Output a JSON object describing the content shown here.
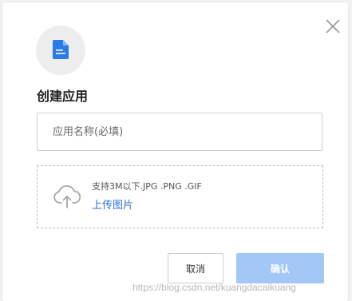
{
  "dialog": {
    "title": "创建应用",
    "close_icon": "close-icon",
    "app_icon": "document-icon",
    "name_input": {
      "placeholder": "应用名称(必填)",
      "value": ""
    },
    "upload": {
      "icon": "cloud-upload-icon",
      "hint": "支持3M以下.JPG .PNG .GIF",
      "link_label": "上传图片"
    },
    "buttons": {
      "cancel_label": "取消",
      "confirm_label": "确认"
    }
  },
  "watermark": "https://blog.csdn.net/kuangdacaikuang",
  "colors": {
    "accent": "#2b6fd8",
    "icon_blue": "#2a7ae8",
    "confirm_disabled": "#a3c8f7"
  }
}
